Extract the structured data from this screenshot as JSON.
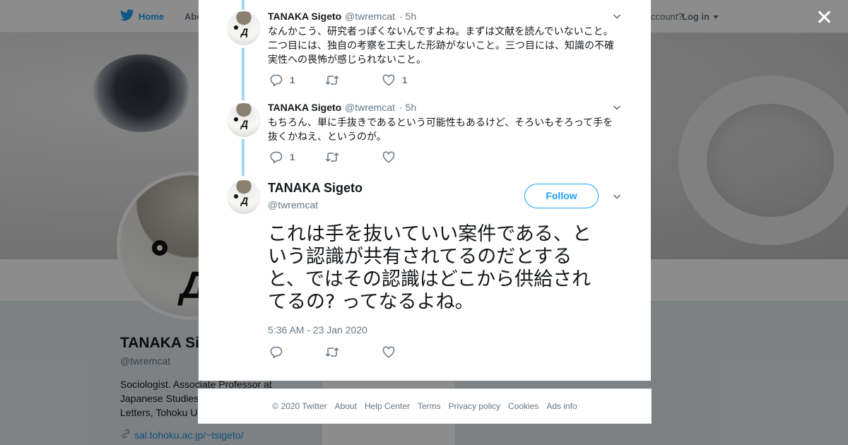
{
  "colors": {
    "brand": "#1da1f2",
    "thread": "#a5d6f5",
    "muted": "#657786"
  },
  "background": {
    "nav": {
      "home": "Home",
      "about": "Abo",
      "account": "ccount?",
      "login": "Log in"
    },
    "profile": {
      "name": "TANAKA Si",
      "handle": "@twremcat",
      "bio_lines": [
        "Sociologist. Associate Professor at",
        "Japanese Studies",
        "Letters, Tohoku U"
      ],
      "link": "sal.tohoku.ac.jp/~tsigeto/",
      "ads_info": "Ads info"
    }
  },
  "thread": [
    {
      "name": "TANAKA Sigeto",
      "handle": "@twremcat",
      "time": "· 5h",
      "text_lines": [
        "なんかこう、研究者っぽくないんですよね。まずは文献を読んでいないこと。",
        "二つ目には、独自の考察を工夫した形跡がないこと。三つ目には、知識の不確",
        "実性への畏怖が感じられないこと。"
      ],
      "replies": "1",
      "retweets": "",
      "likes": "1"
    },
    {
      "name": "TANAKA Sigeto",
      "handle": "@twremcat",
      "time": "· 5h",
      "text_lines": [
        "もちろん、単に手抜きであるという可能性もあるけど、そろいもそろって手を",
        "抜くかねえ、というのが。"
      ],
      "replies": "1",
      "retweets": "",
      "likes": ""
    }
  ],
  "main_tweet": {
    "name": "TANAKA Sigeto",
    "handle": "@twremcat",
    "follow_label": "Follow",
    "text_lines": [
      "これは手を抜いていい案件である、と",
      "いう認識が共有されてるのだとする",
      "と、ではその認識はどこから供給され",
      "てるの? ってなるよね。"
    ],
    "timestamp": "5:36 AM - 23 Jan 2020"
  },
  "footer": {
    "links": [
      "© 2020 Twitter",
      "About",
      "Help Center",
      "Terms",
      "Privacy policy",
      "Cookies",
      "Ads info"
    ]
  },
  "icons": [
    "twitter-bird-icon",
    "close-icon",
    "chevron-down-icon",
    "reply-icon",
    "retweet-icon",
    "like-icon",
    "link-icon"
  ]
}
